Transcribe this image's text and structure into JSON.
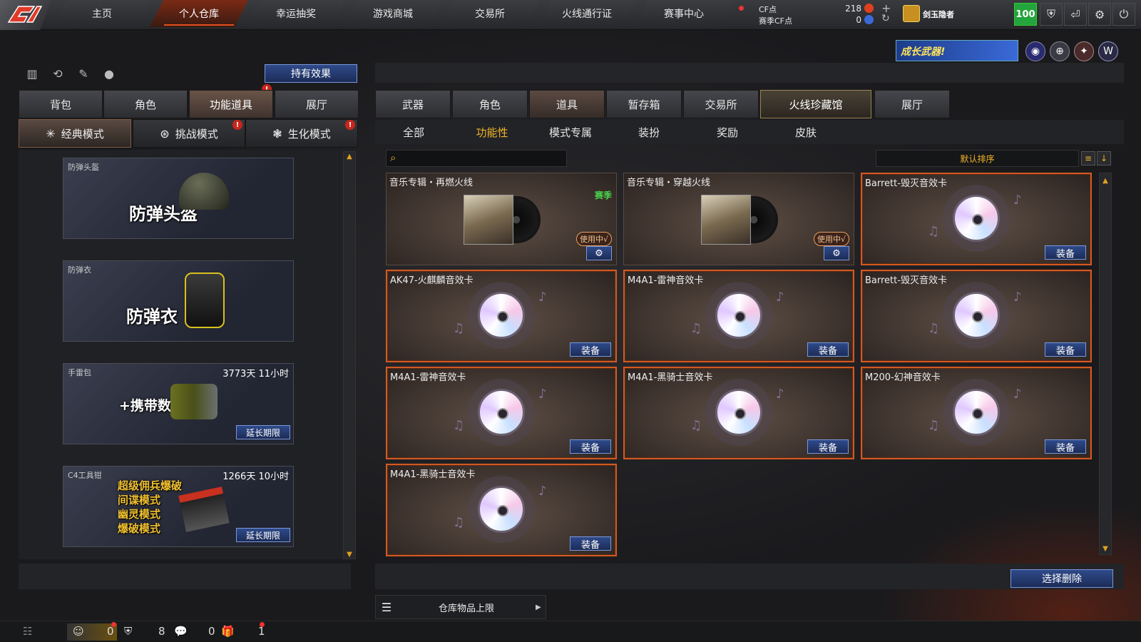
{
  "topnav": {
    "tabs": [
      "主页",
      "个人仓库",
      "幸运抽奖",
      "游戏商城",
      "交易所",
      "火线通行证",
      "赛事中心"
    ],
    "active": 1,
    "cf_label": "CF点",
    "season_cf_label": "赛季CF点",
    "cf_value": "218",
    "season_cf_value": "0",
    "player_name": "剑玉隐者",
    "level_badge": "100"
  },
  "promo": {
    "text": "成长武器!"
  },
  "left": {
    "hold_effect": "持有效果",
    "tabs": [
      "背包",
      "角色",
      "功能道具",
      "展厅"
    ],
    "active_tab": 2,
    "modes": [
      "经典模式",
      "挑战模式",
      "生化模式"
    ],
    "active_mode": 0,
    "items": [
      {
        "name": "防弹头盔",
        "big": "防弹头盔",
        "time": "",
        "button": ""
      },
      {
        "name": "防弹衣",
        "big": "防弹衣",
        "time": "",
        "button": ""
      },
      {
        "name": "手雷包",
        "big": "+携带数",
        "time": "3773天 11小时",
        "button": "延长期限"
      },
      {
        "name": "C4工具钳",
        "big_lines": [
          "超级佣兵爆破",
          "间谍模式",
          "幽灵模式",
          "爆破模式"
        ],
        "time": "1266天 10小时",
        "button": "延长期限"
      }
    ]
  },
  "right": {
    "tabs": [
      "武器",
      "角色",
      "道具",
      "暂存箱",
      "交易所",
      "火线珍藏馆",
      "展厅"
    ],
    "active_tab": 2,
    "subtabs": [
      "全部",
      "功能性",
      "模式专属",
      "装扮",
      "奖励",
      "皮肤"
    ],
    "active_subtab": 1,
    "search_placeholder": "",
    "sort_label": "默认排序",
    "cards": [
      {
        "title": "音乐专辑・再燃火线",
        "tag": "赛季",
        "status": "使用中√",
        "type": "album"
      },
      {
        "title": "音乐专辑・穿越火线",
        "tag": "",
        "status": "使用中√",
        "type": "album"
      },
      {
        "title": "Barrett-毁灭音效卡",
        "button": "装备",
        "type": "disc"
      },
      {
        "title": "AK47-火麒麟音效卡",
        "button": "装备",
        "type": "disc"
      },
      {
        "title": "M4A1-雷神音效卡",
        "button": "装备",
        "type": "disc"
      },
      {
        "title": "Barrett-毁灭音效卡",
        "button": "装备",
        "type": "disc"
      },
      {
        "title": "M4A1-雷神音效卡",
        "button": "装备",
        "type": "disc"
      },
      {
        "title": "M4A1-黑骑士音效卡",
        "button": "装备",
        "type": "disc"
      },
      {
        "title": "M200-幻神音效卡",
        "button": "装备",
        "type": "disc"
      },
      {
        "title": "M4A1-黑骑士音效卡",
        "button": "装备",
        "type": "disc"
      }
    ],
    "delete_button": "选择删除",
    "capacity_label": "仓库物品上限"
  },
  "bottom": {
    "counts": [
      "0",
      "8",
      "0",
      "1"
    ]
  }
}
